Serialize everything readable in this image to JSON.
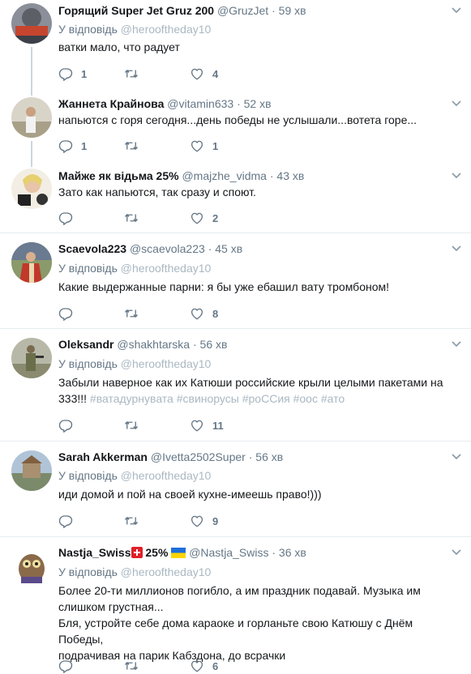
{
  "tweets": [
    {
      "name": "Горящий Super Jet Gruz 200",
      "handle": "@GruzJet",
      "time": "59 хв",
      "reply_prefix": "У відповідь",
      "reply_to": "@herooftheday10",
      "text": "ватки мало, что радует",
      "reply_count": "1",
      "retweet_count": "",
      "like_count": "4"
    },
    {
      "name": "Жаннета Крайнова",
      "handle": "@vitamin633",
      "time": "52 хв",
      "text": "напьются с горя сегодня...день победы не услышали...вотета горе...",
      "reply_count": "1",
      "retweet_count": "",
      "like_count": "1"
    },
    {
      "name": "Майже як відьма 25%",
      "handle": "@majzhe_vidma",
      "time": "43 хв",
      "text": "Зато как напьются, так сразу и споют.",
      "reply_count": "",
      "retweet_count": "",
      "like_count": "2"
    },
    {
      "name": "Scaevola223",
      "handle": "@scaevola223",
      "time": "45 хв",
      "reply_prefix": "У відповідь",
      "reply_to": "@herooftheday10",
      "text": "Какие выдержанные парни: я бы уже ебашил вату тромбоном!",
      "reply_count": "",
      "retweet_count": "",
      "like_count": "8"
    },
    {
      "name": "Oleksandr",
      "handle": "@shakhtarska",
      "time": "56 хв",
      "reply_prefix": "У відповідь",
      "reply_to": "@herooftheday10",
      "text_line1": "Забыли наверное как их Катюши российские крыли целыми пакетами на",
      "text_line2_plain": "333!!!",
      "hashtags": [
        "#ватадурнувата",
        "#свинорусы",
        "#роССия",
        "#оос",
        "#ато"
      ],
      "reply_count": "",
      "retweet_count": "",
      "like_count": "11"
    },
    {
      "name": "Sarah Akkerman",
      "handle": "@Ivetta2502Super",
      "time": "56 хв",
      "reply_prefix": "У відповідь",
      "reply_to": "@herooftheday10",
      "text": "иди домой и пой на своей кухне-имеешь право!)))",
      "reply_count": "",
      "retweet_count": "",
      "like_count": "9"
    },
    {
      "name_part1": "Nastja_Swiss",
      "name_part2": "25%",
      "handle": "@Nastja_Swiss",
      "time": "36 хв",
      "reply_prefix": "У відповідь",
      "reply_to": "@herooftheday10",
      "text_line1": "Более 20-ти миллионов погибло, а им праздник подавай. Музыка им",
      "text_line2": "слишком грустная...",
      "text_line3": "Бля, устройте себе дома караоке и горланьте свою Катюшу с Днём Победы,",
      "text_line4": "подрачивая на парик Кабздона, до всрачки",
      "reply_count": "",
      "retweet_count": "",
      "like_count": "6"
    }
  ],
  "dot": "·",
  "colors": {
    "accent": "#1da1f2",
    "muted": "#657786",
    "light_link": "#aab8c2",
    "divider": "#e6ecf0"
  }
}
